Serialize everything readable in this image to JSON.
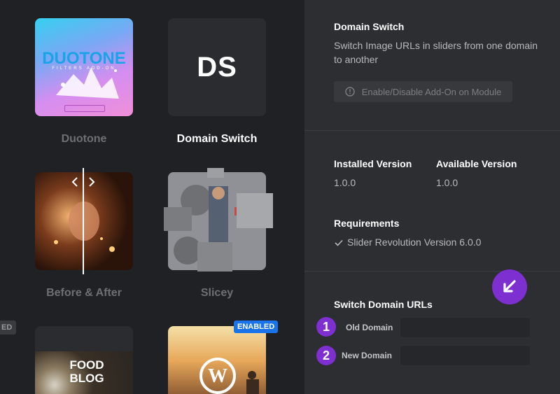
{
  "addons": [
    {
      "name": "Duotone",
      "art_title": "DUOTONE",
      "art_sub": "FILTERS ADD-ON"
    },
    {
      "name": "Domain Switch",
      "art_text": "DS"
    },
    {
      "name": "Before & After"
    },
    {
      "name": "Slicey"
    },
    {
      "name": "Food Blog",
      "art_text": "FOOD\nBLOG"
    },
    {
      "name": "WordPress",
      "badge": "ENABLED"
    }
  ],
  "left_partial_badge": "ED",
  "detail": {
    "title": "Domain Switch",
    "description": "Switch Image URLs in sliders from one domain to another",
    "toggle_button": "Enable/Disable Add-On on Module",
    "installed_label": "Installed Version",
    "installed_value": "1.0.0",
    "available_label": "Available Version",
    "available_value": "1.0.0",
    "requirements_label": "Requirements",
    "requirement_item": "Slider Revolution Version 6.0.0",
    "switch_title": "Switch Domain URLs",
    "old_domain_label": "Old Domain",
    "new_domain_label": "New Domain",
    "old_domain_value": "",
    "new_domain_value": "",
    "step1": "1",
    "step2": "2"
  },
  "colors": {
    "accent_purple": "#7d2fd0",
    "enabled_badge": "#1a73e8"
  },
  "icons": [
    "info-circle-icon",
    "checkmark-icon",
    "arrow-down-left-icon",
    "chevron-left-icon",
    "chevron-right-icon",
    "wordpress-icon"
  ]
}
